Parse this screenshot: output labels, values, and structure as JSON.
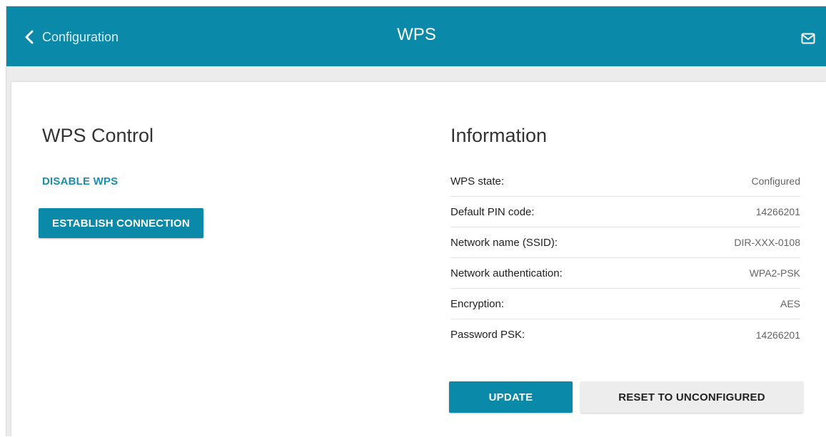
{
  "header": {
    "back_label": "Configuration",
    "title": "WPS",
    "back_icon": "chevron-left-icon",
    "mail_icon": "mail-icon"
  },
  "wps_control": {
    "heading": "WPS Control",
    "disable_label": "DISABLE WPS",
    "establish_label": "ESTABLISH CONNECTION"
  },
  "information": {
    "heading": "Information",
    "rows": [
      {
        "label": "WPS state:",
        "value": "Configured"
      },
      {
        "label": "Default PIN code:",
        "value": "14266201"
      },
      {
        "label": "Network name (SSID):",
        "value": "DIR-XXX-0108"
      },
      {
        "label": "Network authentication:",
        "value": "WPA2-PSK"
      },
      {
        "label": "Encryption:",
        "value": "AES"
      },
      {
        "label": "Password PSK:",
        "value": "14266201"
      }
    ],
    "update_label": "UPDATE",
    "reset_label": "RESET TO UNCONFIGURED"
  },
  "colors": {
    "accent": "#0b89a8",
    "link": "#1a8fb0",
    "page_bg": "#ececec"
  }
}
